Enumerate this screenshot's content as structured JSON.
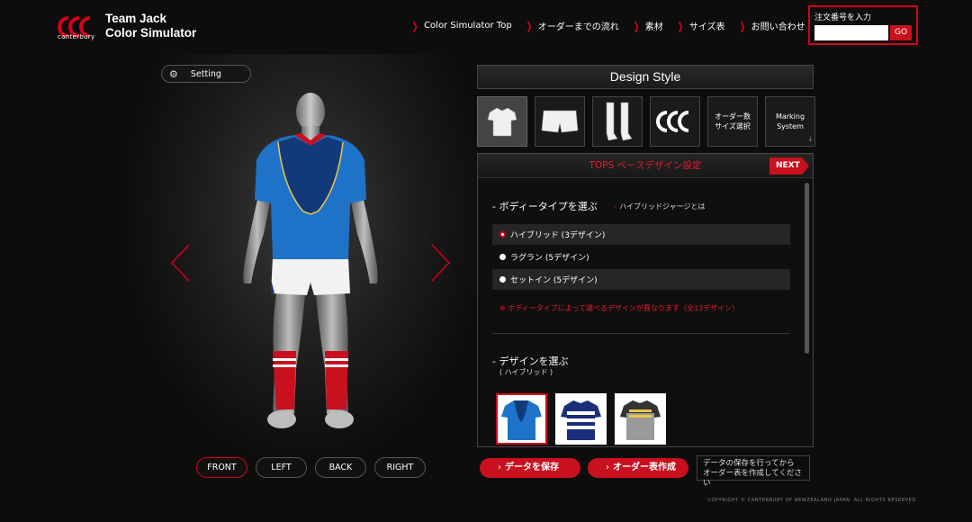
{
  "header": {
    "brand": "canterbury",
    "title_line1": "Team Jack",
    "title_line2": "Color Simulator"
  },
  "nav": [
    {
      "label": "Color Simulator Top"
    },
    {
      "label": "オーダーまでの流れ"
    },
    {
      "label": "素材"
    },
    {
      "label": "サイズ表"
    },
    {
      "label": "お問い合わせ"
    }
  ],
  "order_box": {
    "label": "注文番号を入力",
    "input_value": "",
    "go_label": "GO"
  },
  "setting": {
    "label": "Setting"
  },
  "view_buttons": [
    {
      "label": "FRONT",
      "active": true
    },
    {
      "label": "LEFT"
    },
    {
      "label": "BACK"
    },
    {
      "label": "RIGHT"
    }
  ],
  "design_style": {
    "title": "Design Style",
    "tiles": [
      {
        "icon": "shirt-icon",
        "active": true
      },
      {
        "icon": "shorts-icon"
      },
      {
        "icon": "socks-icon"
      },
      {
        "icon": "canterbury-logo-icon"
      },
      {
        "label": "オーダー数\nサイズ選択"
      },
      {
        "label": "Marking\nSystem"
      }
    ]
  },
  "panel": {
    "title": "TOPS ベースデザイン設定",
    "next_label": "NEXT",
    "body_type_title": "- ボディータイプを選ぶ",
    "body_type_link": "ハイブリッドジャージとは",
    "options": [
      {
        "label": "ハイブリッド (3デザイン)",
        "selected": true
      },
      {
        "label": "ラグラン (5デザイン)"
      },
      {
        "label": "セットイン (5デザイン)"
      }
    ],
    "note": "※ ボディータイプによって選べるデザインが異なります（全13デザイン）",
    "design_title": "- デザインを選ぶ",
    "design_sub": "( ハイブリッド )"
  },
  "actions": {
    "save_label": "データを保存",
    "order_label": "オーダー表作成",
    "save_note": "データの保存を行ってから\nオーダー表を作成してください"
  },
  "copyright": "COPYRIGHT © CANTERBURY OF NEWZEALAND JAPAN. ALL RIGHTS RESERVED.",
  "colors": {
    "accent": "#d6001c",
    "jersey_blue": "#1e73c8",
    "jersey_navy": "#123a7a",
    "sock_red": "#c8101f"
  }
}
